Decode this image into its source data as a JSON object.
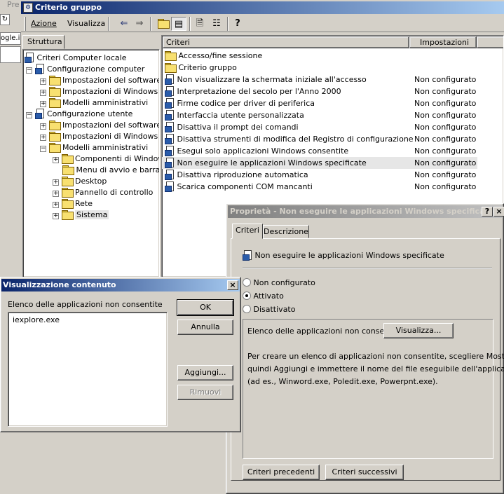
{
  "main_window": {
    "title": "Criterio gruppo",
    "menu": {
      "action": "Azione",
      "view": "Visualizza"
    },
    "tree_tab": "Struttura",
    "tree": [
      "Criteri Computer locale",
      "Configurazione computer",
      "Impostazioni del software",
      "Impostazioni di Windows",
      "Modelli amministrativi",
      "Configurazione utente",
      "Impostazioni del software",
      "Impostazioni di Windows",
      "Modelli amministrativi",
      "Componenti di Windows",
      "Menu di avvio e barra d",
      "Desktop",
      "Pannello di controllo",
      "Rete",
      "Sistema"
    ],
    "columns": {
      "name": "Criteri",
      "setting": "Impostazioni"
    },
    "rows": [
      {
        "name": "Accesso/fine sessione",
        "setting": ""
      },
      {
        "name": "Criterio gruppo",
        "setting": ""
      },
      {
        "name": "Non visualizzare la schermata iniziale all'accesso",
        "setting": "Non configurato"
      },
      {
        "name": "Interpretazione del secolo per l'Anno 2000",
        "setting": "Non configurato"
      },
      {
        "name": "Firme codice per driver di periferica",
        "setting": "Non configurato"
      },
      {
        "name": "Interfaccia utente personalizzata",
        "setting": "Non configurato"
      },
      {
        "name": "Disattiva il prompt dei comandi",
        "setting": "Non configurato"
      },
      {
        "name": "Disattiva strumenti di modifica del Registro di configurazione",
        "setting": "Non configurato"
      },
      {
        "name": "Esegui solo applicazioni Windows consentite",
        "setting": "Non configurato"
      },
      {
        "name": "Non eseguire le applicazioni Windows specificate",
        "setting": "Non configurato"
      },
      {
        "name": "Disattiva riproduzione automatica",
        "setting": "Non configurato"
      },
      {
        "name": "Scarica componenti COM mancanti",
        "setting": "Non configurato"
      }
    ]
  },
  "background": {
    "tab_fragment": "Pre",
    "address_fragment": "ogle.il"
  },
  "properties_dialog": {
    "title": "Proprietà - Non eseguire le applicazioni Windows specificate",
    "help_button": "?",
    "close_button": "×",
    "tabs": [
      "Criteri",
      "Descrizione"
    ],
    "policy_name": "Non eseguire le applicazioni Windows specificate",
    "options": [
      "Non configurato",
      "Attivato",
      "Disattivato"
    ],
    "selected_option": "Attivato",
    "list_label": "Elenco delle applicazioni non consentite",
    "show_button": "Visualizza...",
    "help_text_1": "Per creare un elenco di applicazioni non consentite, scegliere Mostra,",
    "help_text_2": "quindi Aggiungi e immettere il nome del file eseguibile dell'applicazione",
    "help_text_3": "(ad es., Winword.exe, Poledit.exe, Powerpnt.exe).",
    "prev_button": "Criteri precedenti",
    "next_button": "Criteri successivi"
  },
  "contents_dialog": {
    "title": "Visualizzazione contenuto",
    "close_button": "×",
    "list_label": "Elenco delle applicazioni non consentite",
    "items": [
      "iexplore.exe"
    ],
    "ok_button": "OK",
    "cancel_button": "Annulla",
    "add_button": "Aggiungi...",
    "remove_button": "Rimuovi"
  },
  "colors": {
    "active_title": "#0a246a",
    "inactive_title": "#808080",
    "face": "#d4d0c8"
  }
}
